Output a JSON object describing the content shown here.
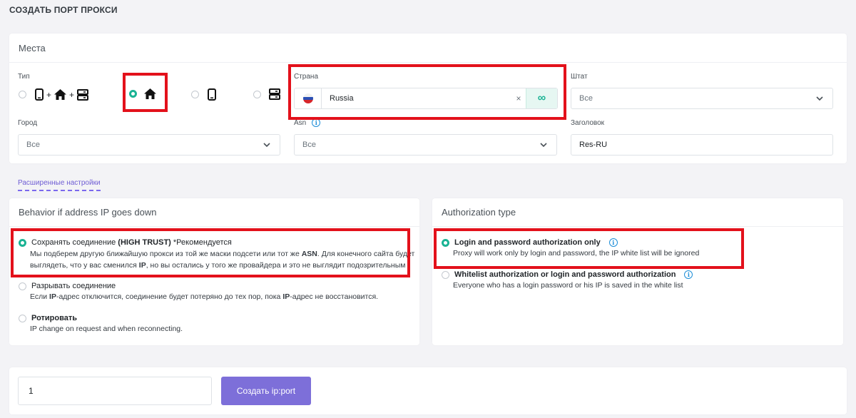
{
  "page": {
    "title": "СОЗДАТЬ ПОРТ ПРОКСИ"
  },
  "places": {
    "title": "Места",
    "type_label": "Тип",
    "country_label": "Страна",
    "country_value": "Russia",
    "state_label": "Штат",
    "state_value": "Все",
    "city_label": "Город",
    "city_value": "Все",
    "asn_label": "Asn",
    "asn_value": "Все",
    "header_label": "Заголовок",
    "header_value": "Res-RU",
    "clear_symbol": "×",
    "infinity_symbol": "∞",
    "type_options": [
      {
        "icons": [
          "phone-icon",
          "house-icon",
          "server-icon"
        ],
        "selected": false
      },
      {
        "icons": [
          "house-icon"
        ],
        "selected": true
      },
      {
        "icons": [
          "phone-icon"
        ],
        "selected": false
      },
      {
        "icons": [
          "server-icon"
        ],
        "selected": false
      }
    ],
    "plus": "+"
  },
  "advanced_link": "Расширенные настройки",
  "behavior": {
    "title": "Behavior if address IP goes down",
    "options": [
      {
        "title_plain": "Сохранять соединение ",
        "title_bold": "(HIGH TRUST)",
        "title_suffix": " *Рекомендуется",
        "desc1_a": "Мы подберем другую ближайшую прокси из той же маски подсети или тот же ",
        "desc1_b": "ASN",
        "desc1_c": ". Для конечного сайта будет",
        "desc2_a": "выглядеть, что у вас сменился ",
        "desc2_b": "IP",
        "desc2_c": ", но вы остались у того же провайдера и это не выглядит подозрительным",
        "selected": true
      },
      {
        "title": "Разрывать соединение",
        "desc_a": "Если ",
        "desc_b": "IP",
        "desc_c": "-адрес отключится, соединение будет потеряно до тех пор, пока ",
        "desc_d": "IP",
        "desc_e": "-адрес не восстановится.",
        "selected": false
      },
      {
        "title": "Ротировать",
        "desc": "IP change on request and when reconnecting.",
        "selected": false
      }
    ]
  },
  "auth": {
    "title": "Authorization type",
    "options": [
      {
        "title": "Login and password authorization only",
        "desc": "Proxy will work only by login and password, the IP white list will be ignored",
        "selected": true
      },
      {
        "title": "Whitelist authorization or login and password authorization",
        "desc": "Everyone who has a login password or his IP is saved in the white list",
        "selected": false
      }
    ]
  },
  "footer": {
    "quantity": "1",
    "create_button": "Создать ip:port"
  },
  "colors": {
    "accent": "#1ab394",
    "button": "#7d6fd9",
    "highlight": "#e3111b",
    "link": "#6f5dd4"
  }
}
